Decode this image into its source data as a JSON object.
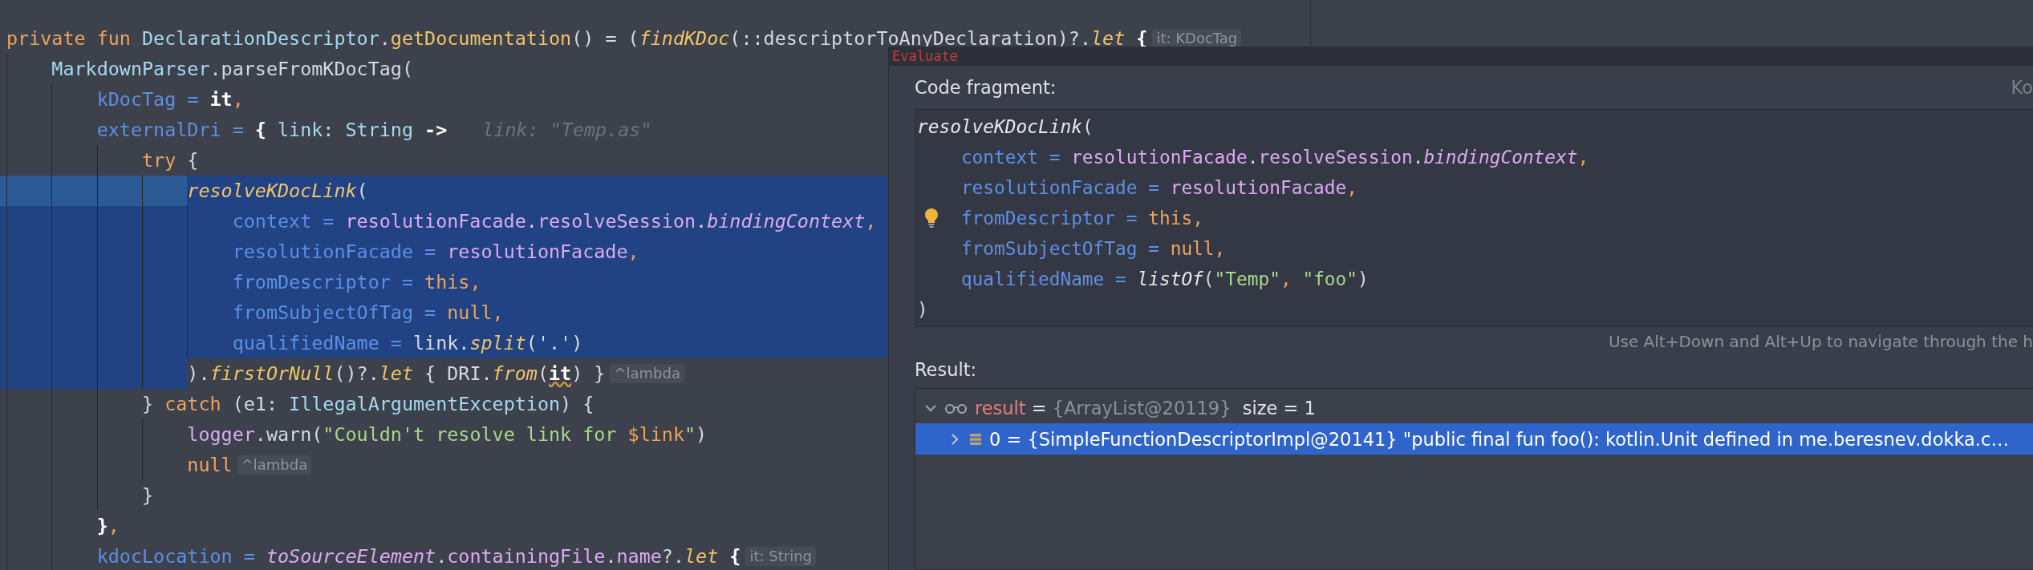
{
  "editor": {
    "lines": [
      {
        "tokens": [
          {
            "text": "private fun ",
            "kind": "kw"
          },
          {
            "text": "DeclarationDescriptor",
            "kind": "type"
          },
          {
            "text": ".",
            "kind": "plain"
          },
          {
            "text": "getDocumentation",
            "kind": "fn"
          },
          {
            "text": "() = (",
            "kind": "plain"
          },
          {
            "text": "findKDoc",
            "kind": "fni"
          },
          {
            "text": "(::descriptorToAnyDeclaration)?.",
            "kind": "plain"
          },
          {
            "text": "let",
            "kind": "fni"
          },
          {
            "text": " {",
            "kind": "bold"
          }
        ],
        "hint": "it: KDocTag",
        "selected": false,
        "indent_selected": false,
        "caret_line": false,
        "children": [
          {
            "tokens": [
              {
                "text": "MarkdownParser",
                "kind": "type"
              },
              {
                "text": ".parseFromKDocTag(",
                "kind": "plain"
              }
            ],
            "selected": false,
            "indent_selected": false,
            "caret_line": false,
            "children": [
              {
                "tokens": [
                  {
                    "text": "kDocTag = ",
                    "kind": "param"
                  },
                  {
                    "text": "it",
                    "kind": "bold"
                  },
                  {
                    "text": ",",
                    "kind": "kw"
                  }
                ],
                "selected": false,
                "indent_selected": false,
                "caret_line": false
              },
              {
                "tokens": [
                  {
                    "text": "externalDri = ",
                    "kind": "param"
                  },
                  {
                    "text": "{ ",
                    "kind": "bold"
                  },
                  {
                    "text": "link",
                    "kind": "type"
                  },
                  {
                    "text": ": ",
                    "kind": "plain"
                  },
                  {
                    "text": "String",
                    "kind": "type"
                  },
                  {
                    "text": " ->",
                    "kind": "bold"
                  }
                ],
                "inline_value": "link: \"Temp.as\"",
                "selected": false,
                "indent_selected": false,
                "caret_line": false,
                "children": [
                  {
                    "tokens": [
                      {
                        "text": "try",
                        "kind": "kw"
                      },
                      {
                        "text": " {",
                        "kind": "plain"
                      }
                    ],
                    "selected": false,
                    "indent_selected": false,
                    "caret_line": false,
                    "children": [
                      {
                        "tokens": [
                          {
                            "text": "resolveKDocLink",
                            "kind": "fni"
                          },
                          {
                            "text": "(",
                            "kind": "plain"
                          }
                        ],
                        "selected": true,
                        "indent_selected": false,
                        "caret_line": true,
                        "children": [
                          {
                            "tokens": [
                              {
                                "text": "context = ",
                                "kind": "param"
                              },
                              {
                                "text": "resolutionFacade",
                                "kind": "prop"
                              },
                              {
                                "text": ".",
                                "kind": "plain"
                              },
                              {
                                "text": "resolveSession",
                                "kind": "prop"
                              },
                              {
                                "text": ".",
                                "kind": "plain"
                              },
                              {
                                "text": "bindingContext",
                                "kind": "propi"
                              },
                              {
                                "text": ",",
                                "kind": "kw"
                              }
                            ],
                            "selected": true,
                            "indent_selected": true,
                            "caret_line": false
                          },
                          {
                            "tokens": [
                              {
                                "text": "resolutionFacade = ",
                                "kind": "param"
                              },
                              {
                                "text": "resolutionFacade",
                                "kind": "prop"
                              },
                              {
                                "text": ",",
                                "kind": "kw"
                              }
                            ],
                            "selected": true,
                            "indent_selected": true,
                            "caret_line": false
                          },
                          {
                            "tokens": [
                              {
                                "text": "fromDescriptor = ",
                                "kind": "param"
                              },
                              {
                                "text": "this",
                                "kind": "kw"
                              },
                              {
                                "text": ",",
                                "kind": "kw"
                              }
                            ],
                            "selected": true,
                            "indent_selected": true,
                            "caret_line": false
                          },
                          {
                            "tokens": [
                              {
                                "text": "fromSubjectOfTag = ",
                                "kind": "param"
                              },
                              {
                                "text": "null",
                                "kind": "kw"
                              },
                              {
                                "text": ",",
                                "kind": "kw"
                              }
                            ],
                            "selected": true,
                            "indent_selected": true,
                            "caret_line": false
                          },
                          {
                            "tokens": [
                              {
                                "text": "qualifiedName = ",
                                "kind": "param"
                              },
                              {
                                "text": "link",
                                "kind": "plain"
                              },
                              {
                                "text": ".",
                                "kind": "plain"
                              },
                              {
                                "text": "split",
                                "kind": "fni"
                              },
                              {
                                "text": "('.')",
                                "kind": "plain"
                              }
                            ],
                            "selected": true,
                            "indent_selected": true,
                            "caret_line": false
                          }
                        ]
                      },
                      {
                        "tokens": [
                          {
                            "text": ").",
                            "kind": "plain"
                          },
                          {
                            "text": "firstOrNull",
                            "kind": "fni"
                          },
                          {
                            "text": "()?.",
                            "kind": "plain"
                          },
                          {
                            "text": "let",
                            "kind": "fni"
                          },
                          {
                            "text": " { DRI.",
                            "kind": "plain"
                          },
                          {
                            "text": "from",
                            "kind": "fni"
                          },
                          {
                            "text": "(",
                            "kind": "plain"
                          },
                          {
                            "text": "it",
                            "kind": "warn"
                          },
                          {
                            "text": ") }",
                            "kind": "plain"
                          }
                        ],
                        "hint": "^lambda",
                        "selected": false,
                        "indent_selected": true,
                        "caret_line": false
                      }
                    ]
                  },
                  {
                    "tokens": [
                      {
                        "text": "} ",
                        "kind": "plain"
                      },
                      {
                        "text": "catch",
                        "kind": "kw"
                      },
                      {
                        "text": " (e1: ",
                        "kind": "plain"
                      },
                      {
                        "text": "IllegalArgumentException",
                        "kind": "type"
                      },
                      {
                        "text": ") {",
                        "kind": "plain"
                      }
                    ],
                    "selected": false,
                    "indent_selected": false,
                    "caret_line": false,
                    "children": [
                      {
                        "tokens": [
                          {
                            "text": "logger",
                            "kind": "prop"
                          },
                          {
                            "text": ".warn(",
                            "kind": "plain"
                          },
                          {
                            "text": "\"Couldn't resolve link for ",
                            "kind": "str"
                          },
                          {
                            "text": "$link",
                            "kind": "kw"
                          },
                          {
                            "text": "\"",
                            "kind": "str"
                          },
                          {
                            "text": ")",
                            "kind": "plain"
                          }
                        ],
                        "selected": false,
                        "indent_selected": false,
                        "caret_line": false
                      },
                      {
                        "tokens": [
                          {
                            "text": "null",
                            "kind": "kw"
                          }
                        ],
                        "hint": "^lambda",
                        "selected": false,
                        "indent_selected": false,
                        "caret_line": false
                      }
                    ]
                  },
                  {
                    "tokens": [
                      {
                        "text": "}",
                        "kind": "plain"
                      }
                    ],
                    "selected": false,
                    "indent_selected": false,
                    "caret_line": false
                  }
                ]
              },
              {
                "tokens": [
                  {
                    "text": "}",
                    "kind": "bold"
                  },
                  {
                    "text": ",",
                    "kind": "kw"
                  }
                ],
                "selected": false,
                "indent_selected": false,
                "caret_line": false
              },
              {
                "tokens": [
                  {
                    "text": "kdocLocation = ",
                    "kind": "param"
                  },
                  {
                    "text": "toSourceElement",
                    "kind": "propi"
                  },
                  {
                    "text": ".",
                    "kind": "plain"
                  },
                  {
                    "text": "containingFile",
                    "kind": "prop"
                  },
                  {
                    "text": ".",
                    "kind": "plain"
                  },
                  {
                    "text": "name",
                    "kind": "prop"
                  },
                  {
                    "text": "?.",
                    "kind": "plain"
                  },
                  {
                    "text": "let",
                    "kind": "fni"
                  },
                  {
                    "text": " {",
                    "kind": "bold"
                  }
                ],
                "hint": "it: String",
                "selected": false,
                "indent_selected": false,
                "caret_line": false
              }
            ]
          }
        ]
      }
    ]
  },
  "dialog": {
    "title": "Evaluate",
    "fragment_label": "Code fragment:",
    "language": "Ko",
    "fragment_lines": [
      {
        "tokens": [
          {
            "text": "resolveKDocLink",
            "kind": "fnw"
          },
          {
            "text": "(",
            "kind": "plain"
          }
        ],
        "children": [
          {
            "tokens": [
              {
                "text": "context = ",
                "kind": "param"
              },
              {
                "text": "resolutionFacade",
                "kind": "prop"
              },
              {
                "text": ".",
                "kind": "plain"
              },
              {
                "text": "resolveSession",
                "kind": "prop"
              },
              {
                "text": ".",
                "kind": "plain"
              },
              {
                "text": "bindingContext",
                "kind": "propi"
              },
              {
                "text": ",",
                "kind": "kw"
              }
            ]
          },
          {
            "tokens": [
              {
                "text": "resolutionFacade = ",
                "kind": "param"
              },
              {
                "text": "resolutionFacade",
                "kind": "prop"
              },
              {
                "text": ",",
                "kind": "kw"
              }
            ]
          },
          {
            "tokens": [
              {
                "text": "fromDescriptor = ",
                "kind": "param"
              },
              {
                "text": "this",
                "kind": "kw"
              },
              {
                "text": ",",
                "kind": "kw"
              }
            ],
            "intention": true
          },
          {
            "tokens": [
              {
                "text": "fromSubjectOfTag = ",
                "kind": "param"
              },
              {
                "text": "null",
                "kind": "kw"
              },
              {
                "text": ",",
                "kind": "kw"
              }
            ]
          },
          {
            "tokens": [
              {
                "text": "qualifiedName = ",
                "kind": "param"
              },
              {
                "text": "listOf",
                "kind": "fnw"
              },
              {
                "text": "(",
                "kind": "plain"
              },
              {
                "text": "\"Temp\"",
                "kind": "str"
              },
              {
                "text": ", ",
                "kind": "kw"
              },
              {
                "text": "\"foo\"",
                "kind": "str"
              },
              {
                "text": ")",
                "kind": "plain"
              }
            ]
          }
        ]
      },
      {
        "tokens": [
          {
            "text": ")",
            "kind": "plain"
          }
        ]
      }
    ],
    "navigation_hint": "Use Alt+Down and Alt+Up to navigate through the h",
    "result_label": "Result:",
    "result_tree": [
      {
        "name": "result",
        "separator": "=",
        "value": "{ArrayList@20119}",
        "extra": "size = 1",
        "expanded": true,
        "selected": false,
        "children": [
          {
            "text": "0 = {SimpleFunctionDescriptorImpl@20141} \"public final fun foo(): kotlin.Unit defined in me.beresnev.dokka.c…",
            "expanded": false,
            "selected": true
          }
        ]
      }
    ]
  }
}
